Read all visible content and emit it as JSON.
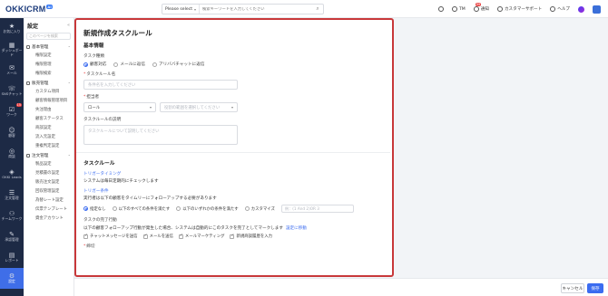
{
  "brand": {
    "name": "OKKICRM",
    "badge": "AI"
  },
  "search": {
    "scope": "Please select",
    "placeholder": "検索キーワードを入力してください"
  },
  "topbar": {
    "user": "TM",
    "notifications_label": "通知",
    "notifications_count": "99",
    "support_label": "カスタマーサポート",
    "help_label": "ヘルプ"
  },
  "rail": [
    {
      "label": "お気に入り",
      "icon": "star-icon"
    },
    {
      "label": "ダッシュボード",
      "icon": "dashboard-icon"
    },
    {
      "label": "メール",
      "icon": "mail-icon"
    },
    {
      "label": "SNSチャット",
      "icon": "chat-icon"
    },
    {
      "label": "ワーク",
      "icon": "work-icon",
      "badge": "15"
    },
    {
      "label": "顧客",
      "icon": "customer-icon"
    },
    {
      "label": "商談",
      "icon": "deal-icon"
    },
    {
      "label": "OKKI Leads",
      "icon": "leads-icon"
    },
    {
      "label": "注文管理",
      "icon": "order-icon"
    },
    {
      "label": "チームワーク",
      "icon": "team-icon"
    },
    {
      "label": "承認管理",
      "icon": "approval-icon"
    },
    {
      "label": "レポート",
      "icon": "report-icon"
    },
    {
      "label": "設定",
      "icon": "settings-icon",
      "active": true
    }
  ],
  "sidebar": {
    "title": "設定",
    "search_placeholder": "このページを検索",
    "groups": [
      {
        "label": "基本管理",
        "items": [
          "権限設定",
          "権限管理",
          "権限検索"
        ]
      },
      {
        "label": "販売管理",
        "items": [
          "カスタム項目",
          "顧客情報管理項目",
          "失注理由",
          "顧客ステータス",
          "商談設定",
          "流入元設定",
          "重複判定設定"
        ]
      },
      {
        "label": "注文管理",
        "items": [
          "製品設定",
          "見積書の設定",
          "販売注文設定",
          "回収管理設定",
          "為替レート設定",
          "伝票テンプレート",
          "資金アカウント"
        ]
      }
    ]
  },
  "form": {
    "title": "新規作成タスクルール",
    "basic_section": "基本情報",
    "task_type_label": "タスク種類",
    "task_types": [
      "顧客対応",
      "メールに返信",
      "アリババチャットに返信"
    ],
    "rule_name_label": "タスクルール名",
    "rule_name_placeholder": "条件名を入力してください",
    "owner_label": "担当者",
    "owner_select": "ロール",
    "owner_role_placeholder": "役割の範囲を選択してください",
    "desc_label": "タスクルールの説明",
    "desc_placeholder": "タスクルールについて説明してください",
    "rule_section": "タスクルール",
    "trigger_timing_label": "トリガータイミング",
    "trigger_timing_text": "システムは毎日定期的にチェックします",
    "trigger_cond_label": "トリガー条件",
    "trigger_cond_text": "実行者は以下の顧客をタイムリーにフォローアップする必要があります",
    "cond_options": [
      "指定なし",
      "以下のすべての条件を満たす",
      "以下のいずれかの条件を満たす",
      "カスタマイズ"
    ],
    "cond_input_placeholder": "例：(1 And 2)OR 3",
    "complete_label": "タスクの完了行動",
    "complete_text": "以下の顧客フォローアップ行動が発生した場合、システムは自動的にこのタスクを完了としてマークします",
    "complete_link": "設定に移動",
    "complete_checks": [
      "チャットメッセージを送信",
      "メールを送信",
      "メールマーケティング",
      "新規商談履歴を入力"
    ],
    "deadline_label": "締切"
  },
  "footer": {
    "cancel_label": "キャンセル",
    "save_label": "保存"
  }
}
